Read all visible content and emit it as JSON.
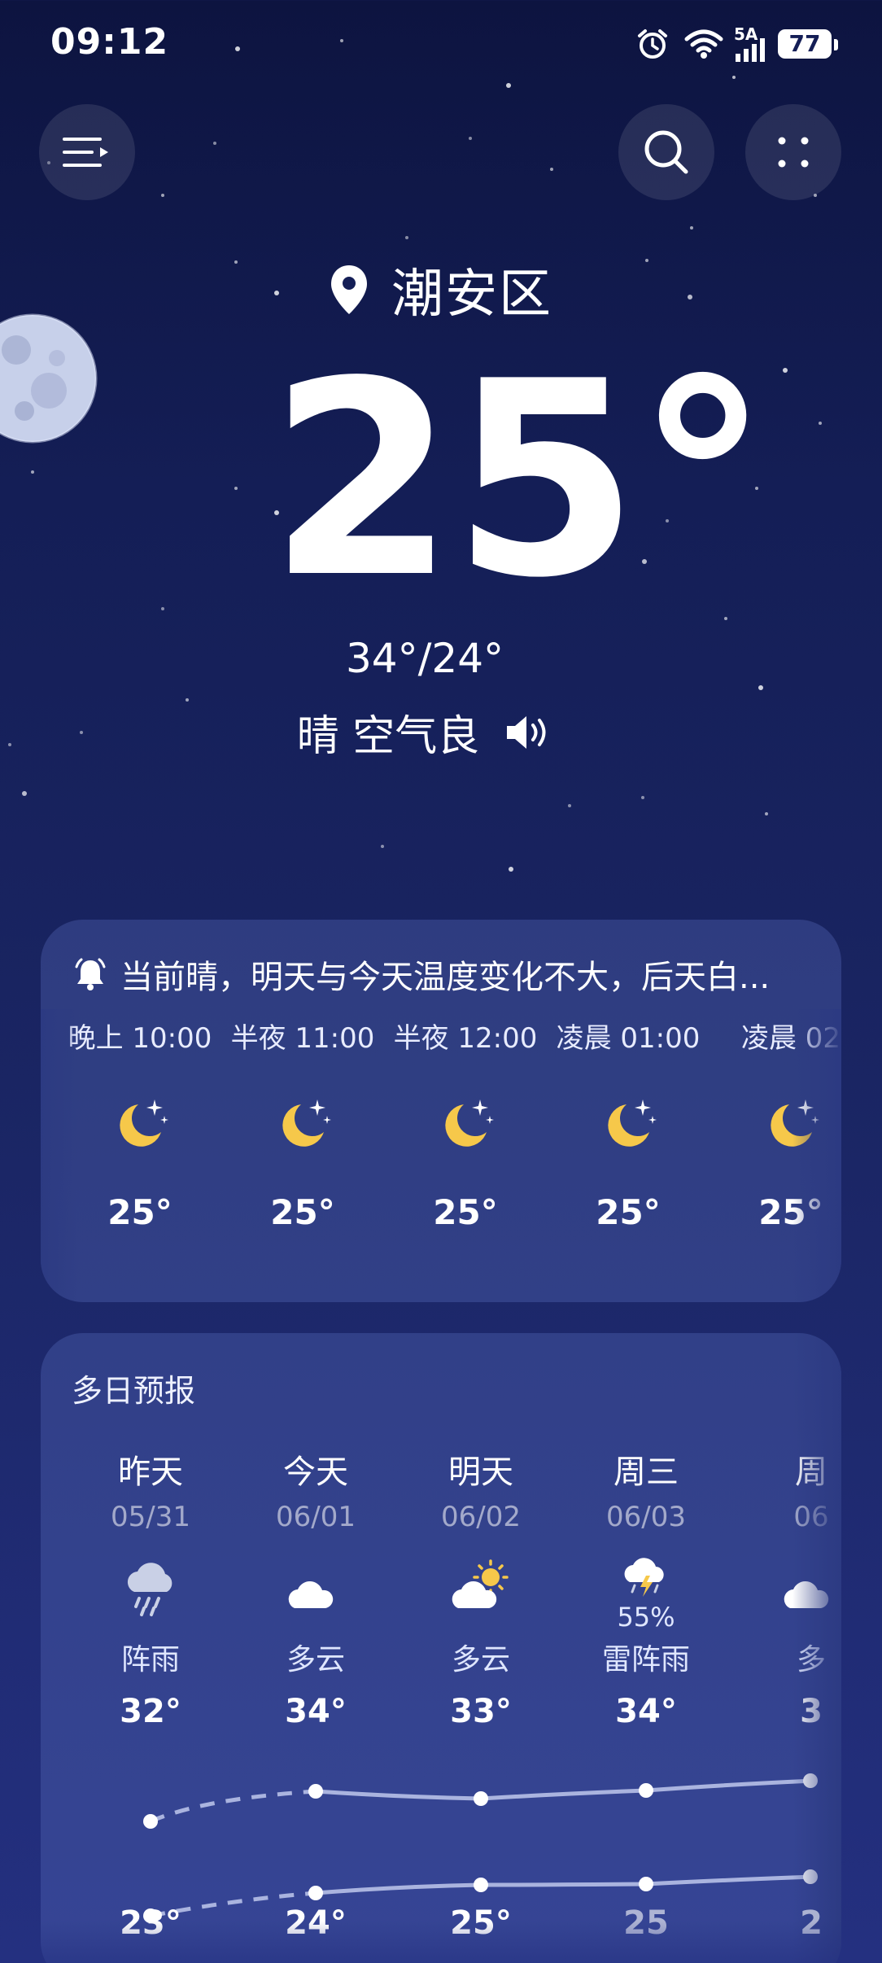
{
  "status": {
    "time": "09:12",
    "network": "5A",
    "battery": "77"
  },
  "header": {
    "location": "潮安区",
    "icons": [
      "menu-icon",
      "search-icon",
      "grid-icon"
    ]
  },
  "current": {
    "temperature": "25°",
    "high_low": "34°/24°",
    "condition": "晴 空气良"
  },
  "hourly": {
    "alert": "当前晴，明天与今天温度变化不大，后天白...",
    "items": [
      {
        "time": "晚上 10:00",
        "temp": "25°",
        "icon": "moon-stars-icon"
      },
      {
        "time": "半夜 11:00",
        "temp": "25°",
        "icon": "moon-stars-icon"
      },
      {
        "time": "半夜 12:00",
        "temp": "25°",
        "icon": "moon-stars-icon"
      },
      {
        "time": "凌晨 01:00",
        "temp": "25°",
        "icon": "moon-stars-icon"
      },
      {
        "time": "凌晨 02",
        "temp": "25°",
        "icon": "moon-stars-icon"
      }
    ]
  },
  "daily": {
    "title": "多日预报",
    "items": [
      {
        "day": "昨天",
        "date": "05/31",
        "cond": "阵雨",
        "high": "32°",
        "low": "23°",
        "pop": "",
        "icon": "rain-cloud-icon"
      },
      {
        "day": "今天",
        "date": "06/01",
        "cond": "多云",
        "high": "34°",
        "low": "24°",
        "pop": "",
        "icon": "cloud-moon-icon"
      },
      {
        "day": "明天",
        "date": "06/02",
        "cond": "多云",
        "high": "33°",
        "low": "25°",
        "pop": "",
        "icon": "cloud-sun-icon"
      },
      {
        "day": "周三",
        "date": "06/03",
        "cond": "雷阵雨",
        "high": "34°",
        "low": "25",
        "pop": "55%",
        "icon": "thunderstorm-icon"
      },
      {
        "day": "周",
        "date": "06",
        "cond": "多",
        "high": "3",
        "low": "2",
        "pop": "",
        "icon": "cloud-icon"
      }
    ]
  },
  "colors": {
    "bg_top": "#0d1440",
    "bg_bottom": "#243080",
    "moon_yellow": "#f6c84a",
    "card": "#3a4a96"
  }
}
